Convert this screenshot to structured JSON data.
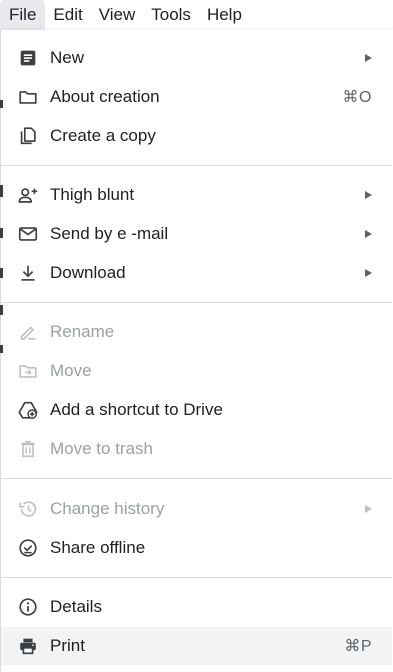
{
  "menubar": {
    "items": [
      "File",
      "Edit",
      "View",
      "Tools",
      "Help"
    ]
  },
  "menu": {
    "items": [
      {
        "label": "New",
        "icon": "document-icon",
        "submenu": true,
        "enabled": true
      },
      {
        "label": "About creation",
        "icon": "folder-icon",
        "shortcut": "⌘O",
        "enabled": true
      },
      {
        "label": "Create a copy",
        "icon": "copy-icon",
        "enabled": true
      },
      {
        "label": "Thigh blunt",
        "icon": "person-add-icon",
        "submenu": true,
        "enabled": true
      },
      {
        "label": "Send by e -mail",
        "icon": "mail-icon",
        "submenu": true,
        "enabled": true
      },
      {
        "label": "Download",
        "icon": "download-icon",
        "submenu": true,
        "enabled": true
      },
      {
        "label": "Rename",
        "icon": "rename-icon",
        "enabled": false
      },
      {
        "label": "Move",
        "icon": "move-folder-icon",
        "enabled": false
      },
      {
        "label": "Add a shortcut to Drive",
        "icon": "drive-shortcut-icon",
        "enabled": true
      },
      {
        "label": "Move to trash",
        "icon": "trash-icon",
        "enabled": false
      },
      {
        "label": "Change history",
        "icon": "history-icon",
        "submenu": true,
        "enabled": false
      },
      {
        "label": "Share offline",
        "icon": "offline-check-icon",
        "enabled": true
      },
      {
        "label": "Details",
        "icon": "info-icon",
        "enabled": true
      },
      {
        "label": "Print",
        "icon": "print-icon",
        "shortcut": "⌘P",
        "enabled": true
      }
    ]
  },
  "colors": {
    "text": "#202124",
    "disabled_text": "#9aa0a6",
    "icon": "#3c4043",
    "disabled_icon": "#bdc1c6",
    "hover_bg": "#f1f3f4",
    "divider": "#dadce0"
  }
}
